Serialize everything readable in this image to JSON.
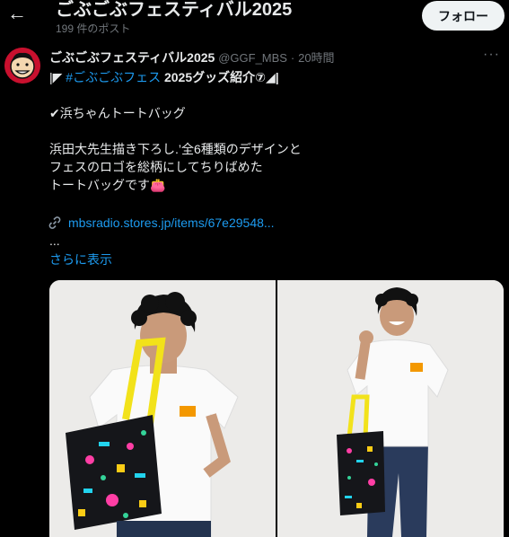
{
  "header": {
    "back_icon": "arrow-left-icon",
    "title": "ごぶごぶフェスティバル2025",
    "subtitle": "199 件のポスト",
    "follow_label": "フォロー"
  },
  "post": {
    "author_name": "ごぶごぶフェスティバル2025",
    "handle": "@GGF_MBS",
    "separator": "·",
    "time": "20時間",
    "more_icon": "more-horizontal-icon",
    "line1_prefix": "|◤",
    "line1_hashtag": "#ごぶごぶフェス",
    "line1_suffix": "2025グッズ紹介⑦◢|",
    "line2": "✔浜ちゃんトートバッグ",
    "line3": "浜田大先生描き下ろし.’全6種類のデザインと",
    "line4": "フェスのロゴを総柄にしてちりばめた",
    "line5": "トートバッグです👛",
    "link_text": "mbsradio.stores.jp/items/67e29548...",
    "ellipsis": "...",
    "show_more": "さらに表示"
  },
  "colors": {
    "background": "#000000",
    "text": "#e7e9ea",
    "muted": "#71767b",
    "link": "#1d9bf0",
    "follow_bg": "#eff3f4"
  }
}
